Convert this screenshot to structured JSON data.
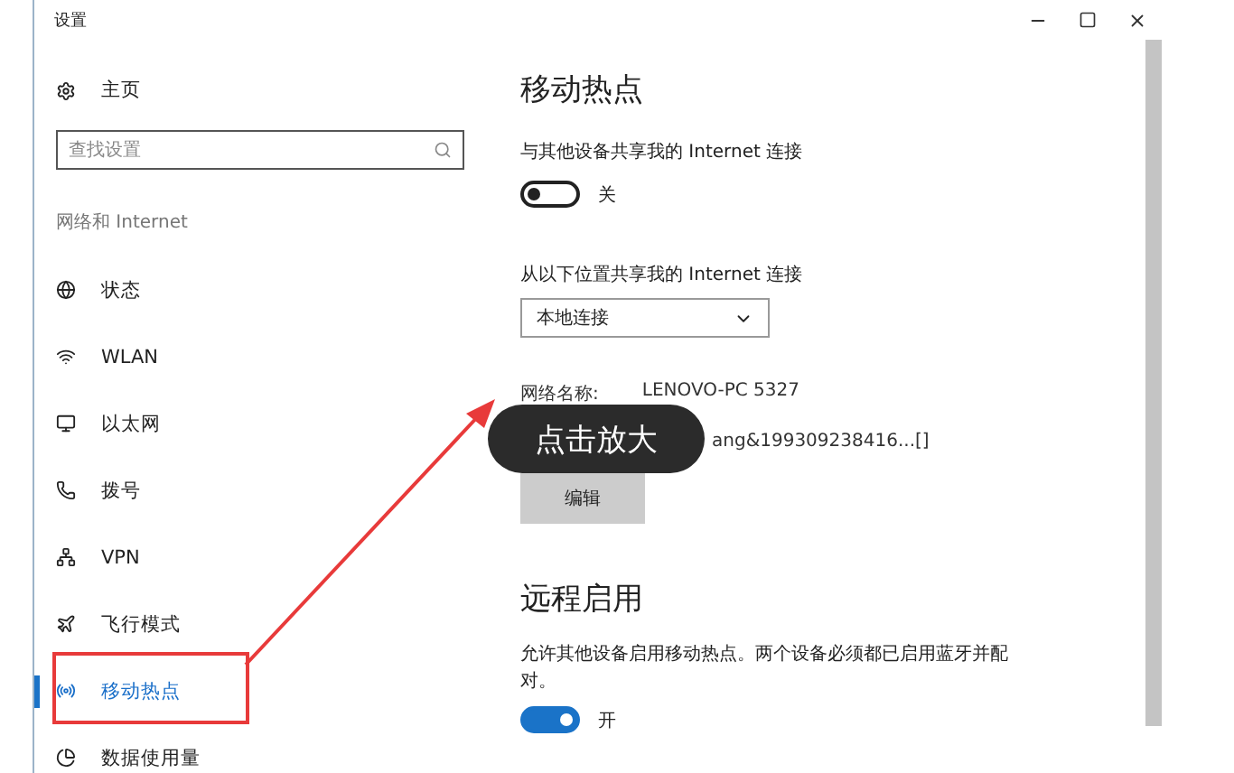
{
  "window": {
    "title": "设置"
  },
  "sidebar": {
    "home": "主页",
    "search": {
      "placeholder": "查找设置"
    },
    "section": "网络和 Internet",
    "items": [
      {
        "label": "状态",
        "selected": false
      },
      {
        "label": "WLAN",
        "selected": false
      },
      {
        "label": "以太网",
        "selected": false
      },
      {
        "label": "拨号",
        "selected": false
      },
      {
        "label": "VPN",
        "selected": false
      },
      {
        "label": "飞行模式",
        "selected": false
      },
      {
        "label": "移动热点",
        "selected": true
      },
      {
        "label": "数据使用量",
        "selected": false
      }
    ]
  },
  "content": {
    "title": "移动热点",
    "share": {
      "label": "与其他设备共享我的 Internet 连接",
      "toggle": {
        "on": false,
        "label": "关"
      }
    },
    "source": {
      "label": "从以下位置共享我的 Internet 连接",
      "value": "本地连接"
    },
    "network_name": {
      "label": "网络名称:",
      "value": "LENOVO-PC 5327"
    },
    "password": {
      "value": "ang&199309238416...[]"
    },
    "edit_button": "编辑",
    "remote": {
      "title": "远程启用",
      "description": "允许其他设备启用移动热点。两个设备必须都已启用蓝牙并配对。",
      "toggle": {
        "on": true,
        "label": "开"
      }
    }
  },
  "overlay": {
    "badge": "点击放大"
  }
}
